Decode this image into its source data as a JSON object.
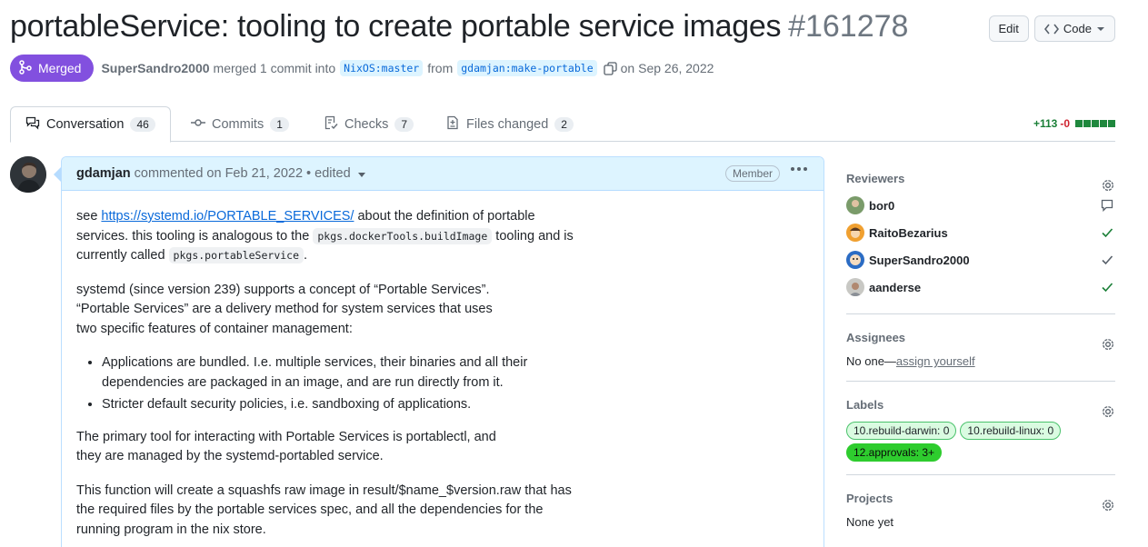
{
  "pr": {
    "title": "portableService: tooling to create portable service images",
    "number": "#161278",
    "status": "Merged",
    "merger": "SuperSandro2000",
    "merge_text": "merged 1 commit into",
    "base_branch": "NixOS:master",
    "from_text": "from",
    "head_branch": "gdamjan:make-portable",
    "date_text": "on Sep 26, 2022"
  },
  "header_actions": {
    "edit": "Edit",
    "code": "Code"
  },
  "tabs": [
    {
      "label": "Conversation",
      "count": "46"
    },
    {
      "label": "Commits",
      "count": "1"
    },
    {
      "label": "Checks",
      "count": "7"
    },
    {
      "label": "Files changed",
      "count": "2"
    }
  ],
  "diffstat": {
    "additions": "+113",
    "deletions": "-0"
  },
  "comment": {
    "author": "gdamjan",
    "meta": "commented on Feb 21, 2022 • edited",
    "role": "Member",
    "p1_pre": "see ",
    "p1_link": "https://systemd.io/PORTABLE_SERVICES/",
    "p1_mid": " about the definition of portable services. this tooling is analogous to the ",
    "p1_code1": "pkgs.dockerTools.buildImage",
    "p1_mid2": " tooling and is currently called ",
    "p1_code2": "pkgs.portableService",
    "p1_end": ".",
    "p2": "systemd (since version 239) supports a concept of “Portable Services”. “Portable Services” are a delivery method for system services that uses two specific features of container management:",
    "bullets": [
      "Applications are bundled. I.e. multiple services, their binaries and all their dependencies are packaged in an image, and are run directly from it.",
      "Stricter default security policies, i.e. sandboxing of applications."
    ],
    "p3": "The primary tool for interacting with Portable Services is portablectl, and they are managed by the systemd-portabled service.",
    "p4": "This function will create a squashfs raw image in result/$name_$version.raw that has the required files by the portable services spec, and all the dependencies for the running program in the nix store."
  },
  "sidebar": {
    "reviewers_title": "Reviewers",
    "reviewers": [
      {
        "name": "bor0",
        "status": "comment"
      },
      {
        "name": "RaitoBezarius",
        "status": "approved"
      },
      {
        "name": "SuperSandro2000",
        "status": "approved"
      },
      {
        "name": "aanderse",
        "status": "approved"
      }
    ],
    "assignees_title": "Assignees",
    "assignees_none": "No one—",
    "assign_link": "assign yourself",
    "labels_title": "Labels",
    "labels": [
      "10.rebuild-darwin: 0",
      "10.rebuild-linux: 0",
      "12.approvals: 3+"
    ],
    "projects_title": "Projects",
    "projects_none": "None yet"
  },
  "colors": {
    "merged": "#8250df",
    "accent_link": "#0969da",
    "approved": "#1a7f37"
  }
}
